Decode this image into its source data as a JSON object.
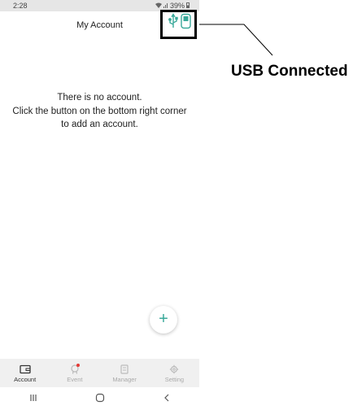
{
  "status_bar": {
    "time": "2:28",
    "battery": "39%"
  },
  "header": {
    "title": "My Account"
  },
  "empty_state": {
    "line1": "There is no account.",
    "line2": "Click the button on the bottom right corner",
    "line3": "to add an account."
  },
  "fab": {
    "icon": "plus-icon",
    "glyph": "+"
  },
  "bottom_nav": {
    "items": [
      {
        "label": "Account",
        "icon": "wallet-icon",
        "active": true
      },
      {
        "label": "Event",
        "icon": "gift-icon",
        "active": false
      },
      {
        "label": "Manager",
        "icon": "device-icon",
        "active": false
      },
      {
        "label": "Setting",
        "icon": "gear-icon",
        "active": false
      }
    ]
  },
  "callout": {
    "label": "USB Connected"
  },
  "colors": {
    "accent": "#3aa99a",
    "nav_bg": "#f0f0f0",
    "badge": "#e53935"
  }
}
